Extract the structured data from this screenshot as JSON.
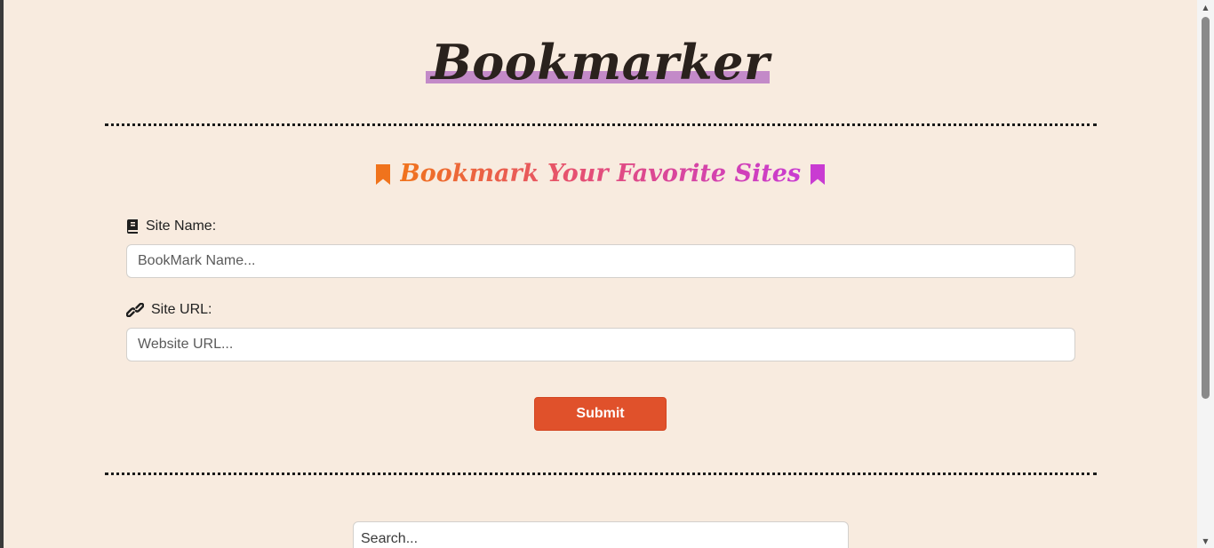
{
  "brand": {
    "title": "Bookmarker"
  },
  "form": {
    "heading": "Bookmark Your Favorite Sites",
    "heading_icon_left": "bookmark-icon",
    "heading_icon_right": "bookmark-icon",
    "site_name": {
      "label": "Site Name:",
      "icon": "book-icon",
      "placeholder": "BookMark Name...",
      "value": ""
    },
    "site_url": {
      "label": "Site URL:",
      "icon": "link-icon",
      "placeholder": "Website URL...",
      "value": ""
    },
    "submit_label": "Submit"
  },
  "search": {
    "placeholder": "Search...",
    "value": ""
  },
  "colors": {
    "background": "#f8ebdf",
    "brand_highlight": "#c38ac8",
    "submit": "#e0512b",
    "heading_gradient_start": "#f0731c",
    "heading_gradient_end": "#c93bd2"
  }
}
